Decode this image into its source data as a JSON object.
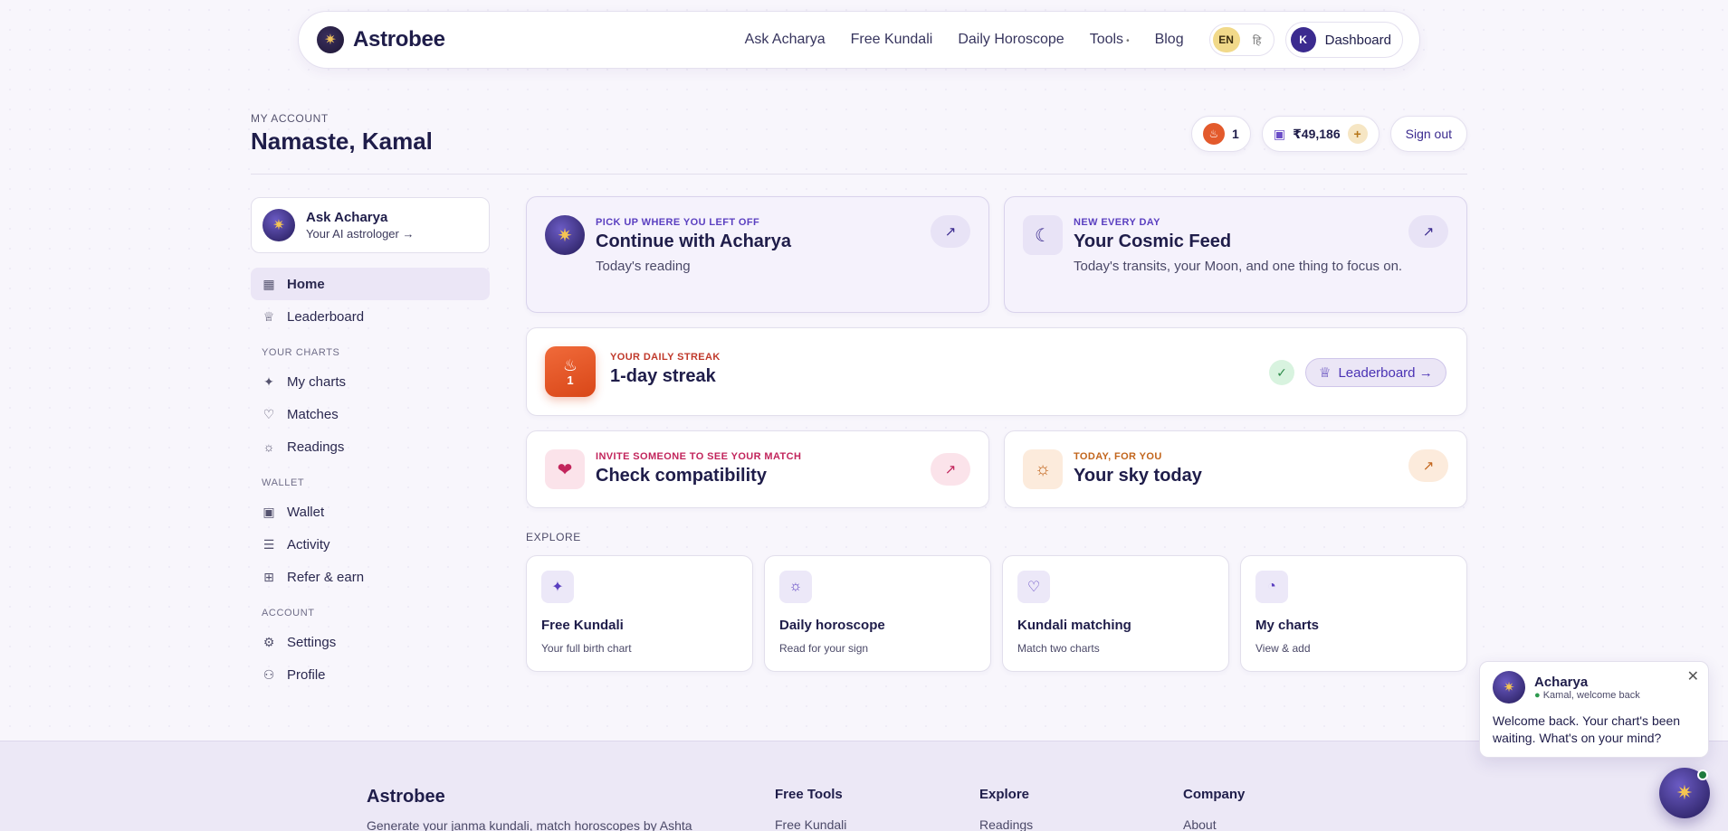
{
  "brand": {
    "name": "Astrobee",
    "logo_icon": "star-icon"
  },
  "nav": {
    "links": [
      "Ask Acharya",
      "Free Kundali",
      "Daily Horoscope",
      "Tools",
      "Blog"
    ],
    "tools_dot": "•",
    "lang_active": "EN",
    "lang_other": "हि",
    "dashboard_initial": "K",
    "dashboard_label": "Dashboard"
  },
  "header": {
    "eyebrow": "MY ACCOUNT",
    "greeting": "Namaste, Kamal",
    "streak_count": "1",
    "wallet_balance": "₹49,186",
    "wallet_add": "+",
    "sign_out": "Sign out"
  },
  "sidebar": {
    "ask_title": "Ask Acharya",
    "ask_sub": "Your AI astrologer →",
    "home": "Home",
    "leaderboard": "Leaderboard",
    "section_charts": "YOUR CHARTS",
    "my_charts": "My charts",
    "matches": "Matches",
    "readings": "Readings",
    "section_wallet": "WALLET",
    "wallet": "Wallet",
    "activity": "Activity",
    "refer": "Refer & earn",
    "section_account": "ACCOUNT",
    "settings": "Settings",
    "profile": "Profile"
  },
  "cards": {
    "continue": {
      "eyebrow": "PICK UP WHERE YOU LEFT OFF",
      "title": "Continue with Acharya",
      "sub": "Today's reading"
    },
    "cosmic": {
      "eyebrow": "NEW EVERY DAY",
      "title": "Your Cosmic Feed",
      "sub": "Today's transits, your Moon, and one thing to focus on."
    },
    "streak": {
      "eyebrow": "YOUR DAILY STREAK",
      "title": "1-day streak",
      "count": "1",
      "leaderboard": "Leaderboard →"
    },
    "compat": {
      "eyebrow": "INVITE SOMEONE TO SEE YOUR MATCH",
      "title": "Check compatibility"
    },
    "sky": {
      "eyebrow": "TODAY, FOR YOU",
      "title": "Your sky today"
    }
  },
  "explore": {
    "label": "EXPLORE",
    "items": [
      {
        "title": "Free Kundali",
        "sub": "Your full birth chart"
      },
      {
        "title": "Daily horoscope",
        "sub": "Read for your sign"
      },
      {
        "title": "Kundali matching",
        "sub": "Match two charts"
      },
      {
        "title": "My charts",
        "sub": "View & add"
      }
    ]
  },
  "footer": {
    "brand": "Astrobee",
    "tagline": "Generate your janma kundali, match horoscopes by Ashta",
    "cols": [
      {
        "head": "Free Tools",
        "first": "Free Kundali"
      },
      {
        "head": "Explore",
        "first": "Readings"
      },
      {
        "head": "Company",
        "first": "About"
      }
    ]
  },
  "chat": {
    "name": "Acharya",
    "status": "Kamal, welcome back",
    "message": "Welcome back. Your chart's been waiting. What's on your mind?"
  },
  "colors": {
    "accent": "#3b2b8f",
    "streak": "#e35a2c",
    "gold": "#f1d98a"
  }
}
